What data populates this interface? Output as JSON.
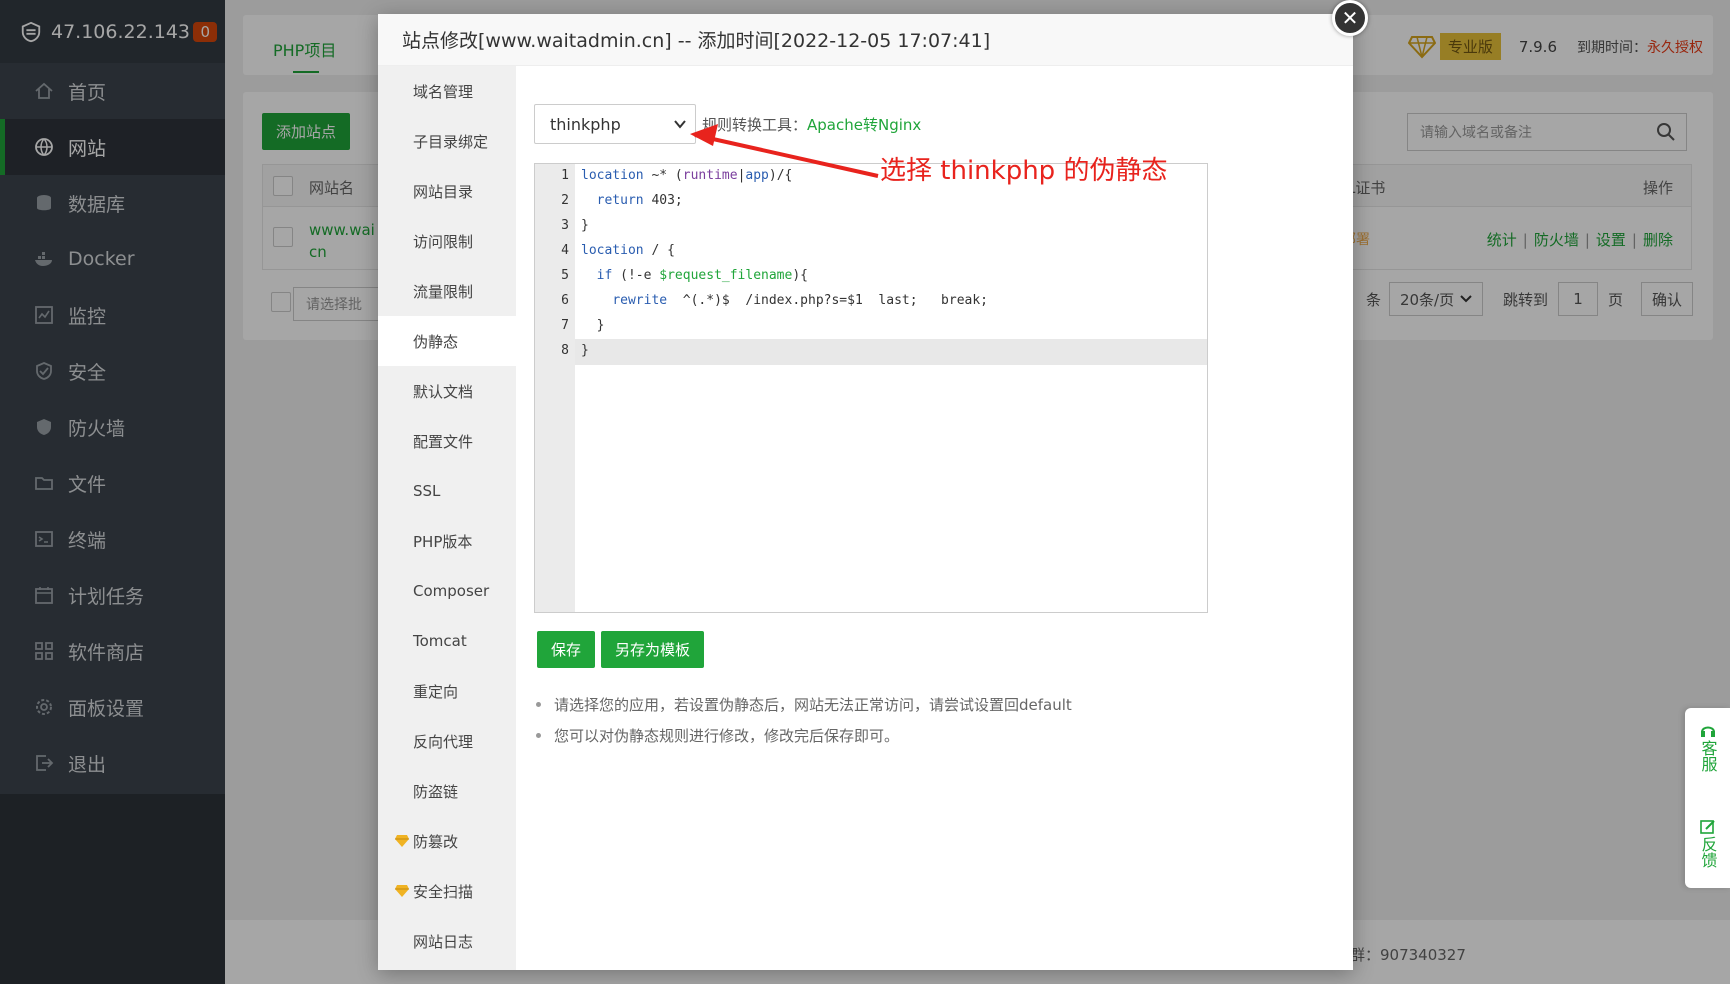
{
  "sidebar": {
    "server_ip": "47.106.22.143",
    "badge": "0",
    "items": [
      {
        "label": "首页",
        "icon": "home-icon"
      },
      {
        "label": "网站",
        "icon": "globe-icon"
      },
      {
        "label": "数据库",
        "icon": "database-icon"
      },
      {
        "label": "Docker",
        "icon": "docker-icon"
      },
      {
        "label": "监控",
        "icon": "monitor-icon"
      },
      {
        "label": "安全",
        "icon": "shield-icon"
      },
      {
        "label": "防火墙",
        "icon": "firewall-icon"
      },
      {
        "label": "文件",
        "icon": "folder-icon"
      },
      {
        "label": "终端",
        "icon": "terminal-icon"
      },
      {
        "label": "计划任务",
        "icon": "calendar-icon"
      },
      {
        "label": "软件商店",
        "icon": "apps-icon"
      },
      {
        "label": "面板设置",
        "icon": "gear-icon"
      },
      {
        "label": "退出",
        "icon": "logout-icon"
      }
    ],
    "active_index": 1
  },
  "header": {
    "tab": "PHP项目",
    "edition": "专业版",
    "version": "7.9.6",
    "expire_label": "到期时间：",
    "expire_value": "永久授权"
  },
  "panel": {
    "add_site": "添加站点",
    "search_placeholder": "请输入域名或备注",
    "col_site": "网站名",
    "col_ssl": "SSL证书",
    "col_ops": "操作",
    "row": {
      "site_line1": "www.wai",
      "site_line2": "cn",
      "ssl": "未部署",
      "ops": [
        "统计",
        "防火墙",
        "设置",
        "删除"
      ]
    },
    "batch_placeholder": "请选择批",
    "pager": {
      "per_page": "20条/页",
      "jump_label": "跳转到",
      "page_value": "1",
      "page_suffix": "页",
      "confirm": "确认",
      "count_suffix": "条"
    }
  },
  "footer": {
    "qq": "群：907340327"
  },
  "float_widget": {
    "service": "客服",
    "feedback": "反馈"
  },
  "modal": {
    "title": "站点修改[www.waitadmin.cn] -- 添加时间[2022-12-05 17:07:41]",
    "close_icon": "close-icon",
    "menu": [
      {
        "label": "域名管理"
      },
      {
        "label": "子目录绑定"
      },
      {
        "label": "网站目录"
      },
      {
        "label": "访问限制"
      },
      {
        "label": "流量限制"
      },
      {
        "label": "伪静态"
      },
      {
        "label": "默认文档"
      },
      {
        "label": "配置文件"
      },
      {
        "label": "SSL"
      },
      {
        "label": "PHP版本"
      },
      {
        "label": "Composer"
      },
      {
        "label": "Tomcat"
      },
      {
        "label": "重定向"
      },
      {
        "label": "反向代理"
      },
      {
        "label": "防盗链"
      },
      {
        "label": "防篡改",
        "pro": true
      },
      {
        "label": "安全扫描",
        "pro": true
      },
      {
        "label": "网站日志"
      }
    ],
    "active_menu_index": 5,
    "rewrite": {
      "selected_rule": "thinkphp",
      "convert_label": "规则转换工具：",
      "convert_link": "Apache转Nginx",
      "code_lines": [
        "location ~* (runtime|app)/{",
        "  return 403;",
        "}",
        "location / {",
        "  if (!-e $request_filename){",
        "    rewrite  ^(.*)$  /index.php?s=$1  last;   break;",
        "  }",
        "}"
      ],
      "active_line": 8,
      "save": "保存",
      "save_template": "另存为模板",
      "tips": [
        "请选择您的应用，若设置伪静态后，网站无法正常访问，请尝试设置回default",
        "您可以对伪静态规则进行修改，修改完后保存即可。"
      ]
    }
  },
  "annotation": {
    "text": "选择 thinkphp 的伪静态",
    "color": "#e8231d"
  }
}
